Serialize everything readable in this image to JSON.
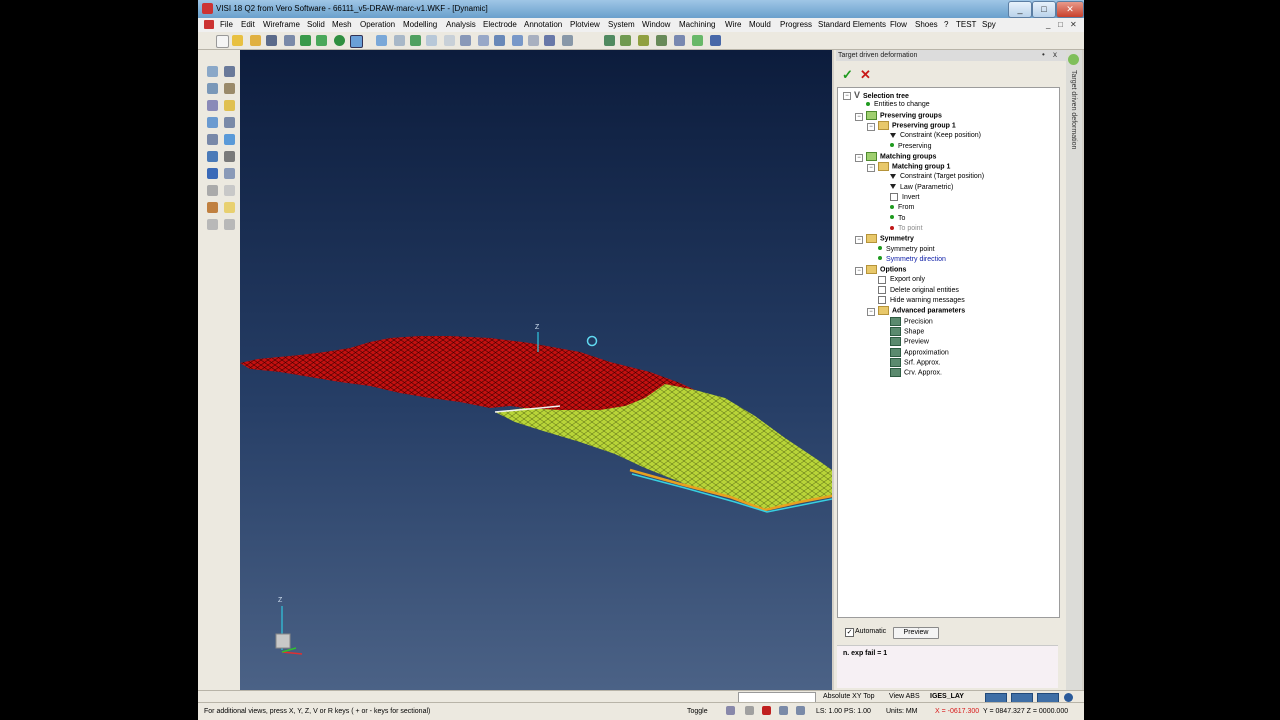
{
  "window": {
    "title": "VISI 18 Q2 from Vero Software - 66111_v5-DRAW-marc-v1.WKF - [Dynamic]",
    "minimize": "_",
    "maximize": "□",
    "close": "✕"
  },
  "menu": {
    "items": [
      "File",
      "Edit",
      "Wireframe",
      "Solid",
      "Mesh",
      "Operation",
      "Modelling",
      "Analysis",
      "Electrode",
      "Annotation",
      "Plotview",
      "System",
      "Window",
      "Machining",
      "Wire",
      "Mould",
      "Progress",
      "Standard Elements",
      "Flow",
      "Shoes",
      "?",
      "TEST",
      "Spy"
    ],
    "mdi_min": "_",
    "mdi_max": "□",
    "mdi_close": "✕"
  },
  "viewport": {
    "axis_label": "Z",
    "triad_label": "Z"
  },
  "panel": {
    "title": "Target driven deformation",
    "pin": "•",
    "close": "x",
    "sidetab_label": "Target driven deformation",
    "tree": [
      {
        "label": "Selection tree",
        "style": "bold",
        "icon": "v"
      },
      {
        "label": "Entities to change",
        "style": "",
        "icon": "g"
      },
      {
        "label": "Preserving groups",
        "style": "bold",
        "icon": "folder-green"
      },
      {
        "label": "Preserving group 1",
        "style": "bold",
        "icon": "folder"
      },
      {
        "label": "Constraint (Keep position)",
        "style": "",
        "icon": "tri"
      },
      {
        "label": "Preserving",
        "style": "",
        "icon": "g"
      },
      {
        "label": "Matching groups",
        "style": "bold",
        "icon": "folder-green"
      },
      {
        "label": "Matching group 1",
        "style": "bold",
        "icon": "folder"
      },
      {
        "label": "Constraint (Target position)",
        "style": "",
        "icon": "tri"
      },
      {
        "label": "Law (Parametric)",
        "style": "",
        "icon": "tri"
      },
      {
        "label": "Invert",
        "style": "",
        "icon": "chk"
      },
      {
        "label": "From",
        "style": "",
        "icon": "g"
      },
      {
        "label": "To",
        "style": "",
        "icon": "g"
      },
      {
        "label": "To point",
        "style": "grey",
        "icon": "r"
      },
      {
        "label": "Symmetry",
        "style": "bold",
        "icon": "folder"
      },
      {
        "label": "Symmetry point",
        "style": "",
        "icon": "g"
      },
      {
        "label": "Symmetry direction",
        "style": "blue",
        "icon": "g"
      },
      {
        "label": "Options",
        "style": "bold",
        "icon": "folder"
      },
      {
        "label": "Export only",
        "style": "",
        "icon": "chk"
      },
      {
        "label": "Delete original entities",
        "style": "",
        "icon": "chk"
      },
      {
        "label": "Hide warning messages",
        "style": "",
        "icon": "chk"
      },
      {
        "label": "Advanced parameters",
        "style": "bold",
        "icon": "folder"
      },
      {
        "label": "Precision",
        "style": "",
        "icon": "gear"
      },
      {
        "label": "Shape",
        "style": "",
        "icon": "gear"
      },
      {
        "label": "Preview",
        "style": "",
        "icon": "gear"
      },
      {
        "label": "Approximation",
        "style": "",
        "icon": "gear"
      },
      {
        "label": "Srf. Approx.",
        "style": "",
        "icon": "gear"
      },
      {
        "label": "Crv. Approx.",
        "style": "",
        "icon": "gear"
      }
    ],
    "automatic_label": "Automatic",
    "automatic_checked": "✓",
    "preview_button": "Preview",
    "message": "n. exp fail = 1"
  },
  "statusbar": {
    "view_mode": "Absolute XY Top",
    "view_abs": "View ABS",
    "layer": "IGES_LAY",
    "hint": "For additional views, press X, Y, Z, V or R keys ( + or - keys for sectional)",
    "toggle": "Toggle",
    "ls_ps": "LS: 1.00 PS: 1.00",
    "units": "Units: MM",
    "coord_x": "X = -0617.300",
    "coord_yz": "Y = 0847.327 Z = 0000.000"
  },
  "colors": {
    "title_gradient_top": "#9fc6e6",
    "viewport_top": "#0c1c3c",
    "viewport_bottom": "#4b6286",
    "model_red": "#c41010",
    "model_yellow": "#b8d438",
    "model_edge_cyan": "#38d0e0",
    "model_edge_orange": "#e8a020"
  }
}
